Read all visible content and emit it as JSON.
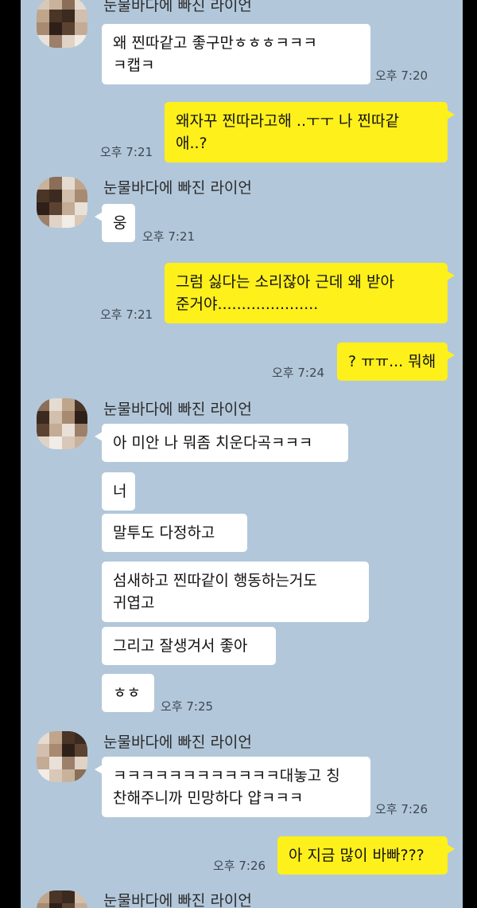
{
  "colors": {
    "chat_background": "#b2c7da",
    "incoming_bubble": "#ffffff",
    "outgoing_bubble": "#fef01b",
    "avatar_tiles": [
      "#d9c8b8",
      "#c9b29c",
      "#8a6e58",
      "#e6dbd0",
      "#bfa58c",
      "#4a3526",
      "#3b2a1f",
      "#d2bfae",
      "#a88a70",
      "#2e2018",
      "#5c4331",
      "#c4ab95",
      "#e9e1d8",
      "#9c806a",
      "#e0d3c6",
      "#f1ece6"
    ]
  },
  "contact": {
    "name": "눈물바다에 빠진 라이언"
  },
  "messages": {
    "m1": {
      "text": "왜 찐따같고 좋구만ㅎㅎㅎㅋㅋㅋ\nㅋ캡ㅋ",
      "time": "오후 7:20"
    },
    "m2": {
      "text": "왜자꾸 찐따라고해 ..ㅜㅜ 나 찐따같\n애..?",
      "time": "오후 7:21"
    },
    "m3": {
      "text": "웅",
      "time": "오후 7:21"
    },
    "m4": {
      "text": "그럼 싫다는 소리잖아 근데 왜 받아\n준거야.....................",
      "time": "오후 7:21"
    },
    "m5": {
      "text": "? ㅠㅠ... 뭐해",
      "time": "오후 7:24"
    },
    "m6": {
      "text": "아 미안 나 뭐좀 치운다곡ㅋㅋㅋ"
    },
    "m7": {
      "text": "너"
    },
    "m8": {
      "text": "말투도 다정하고"
    },
    "m9": {
      "text": "섬새하고 찐따같이 행동하는거도\n귀엽고"
    },
    "m10": {
      "text": "그리고 잘생겨서 좋아"
    },
    "m11": {
      "text": "ㅎㅎ",
      "time": "오후 7:25"
    },
    "m12": {
      "text": "ㅋㅋㅋㅋㅋㅋㅋㅋㅋㅋㅋㅋ대놓고 칭\n찬해주니까 민망하다 얍ㅋㅋㅋ",
      "time": "오후 7:26"
    },
    "m13": {
      "text": "아 지금 많이 바빠???",
      "time": "오후 7:26"
    }
  }
}
